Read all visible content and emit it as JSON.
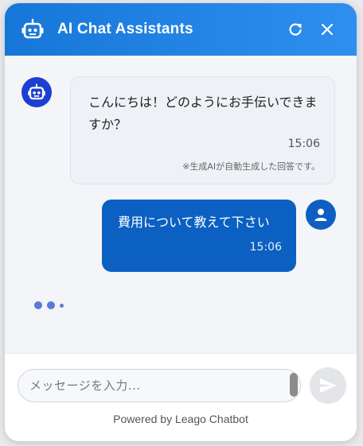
{
  "header": {
    "title": "AI Chat Assistants",
    "logo_icon": "robot-icon",
    "refresh_icon": "refresh-icon",
    "close_icon": "close-icon",
    "color": "#1f83e6"
  },
  "messages": [
    {
      "sender": "bot",
      "avatar_icon": "robot-icon",
      "text": "こんにちは！どのようにお手伝いできますか？",
      "time": "15:06",
      "note": "※生成AIが自動生成した回答です。"
    },
    {
      "sender": "user",
      "avatar_icon": "user-icon",
      "text": "費用について教えて下さい",
      "time": "15:06"
    }
  ],
  "typing_indicator": {
    "state": "typing"
  },
  "composer": {
    "placeholder": "メッセージを入力...",
    "value": "",
    "send_icon": "send-icon"
  },
  "footer": {
    "powered_by": "Powered by Leago Chatbot"
  },
  "colors": {
    "brand": "#1f83e6",
    "user_bubble": "#0b60c2",
    "bot_avatar": "#1d3fd1"
  }
}
